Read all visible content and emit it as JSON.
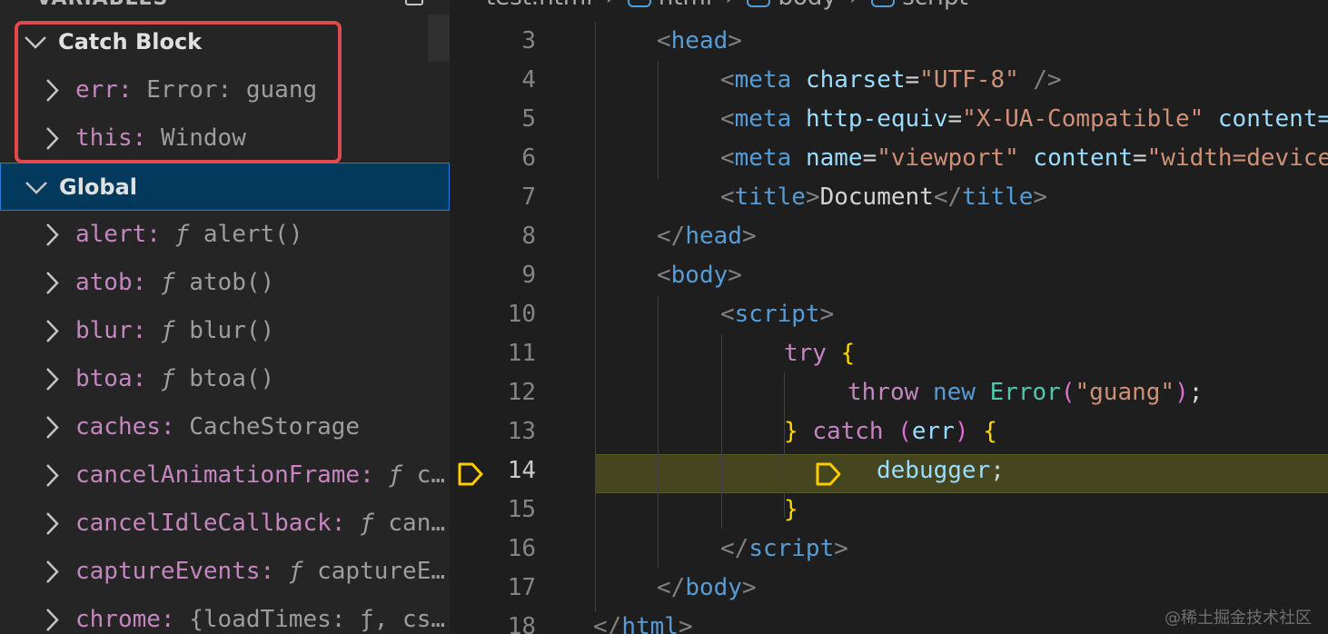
{
  "panel": {
    "title": "VARIABLES",
    "scopes": [
      {
        "label": "Catch Block",
        "expanded": true,
        "selected": false,
        "vars": [
          {
            "name": "err",
            "value": "Error: guang",
            "fn": false
          },
          {
            "name": "this",
            "value": "Window",
            "fn": false
          }
        ]
      },
      {
        "label": "Global",
        "expanded": true,
        "selected": true,
        "vars": [
          {
            "name": "alert",
            "value": "alert()",
            "fn": true
          },
          {
            "name": "atob",
            "value": "atob()",
            "fn": true
          },
          {
            "name": "blur",
            "value": "blur()",
            "fn": true
          },
          {
            "name": "btoa",
            "value": "btoa()",
            "fn": true
          },
          {
            "name": "caches",
            "value": "CacheStorage",
            "fn": false
          },
          {
            "name": "cancelAnimationFrame",
            "value": "c…",
            "fn": true
          },
          {
            "name": "cancelIdleCallback",
            "value": "can…",
            "fn": true
          },
          {
            "name": "captureEvents",
            "value": "captureE…",
            "fn": true
          },
          {
            "name": "chrome",
            "value": "{loadTimes: ƒ, cs…",
            "fn": false
          }
        ]
      }
    ],
    "fn_glyph": "ƒ"
  },
  "editor": {
    "breadcrumb": [
      "test.html",
      "html",
      "body",
      "script"
    ],
    "current_line": 14,
    "lines": [
      {
        "n": "3",
        "indent": 2,
        "tokens": [
          [
            "br",
            "<"
          ],
          [
            "tag",
            "head"
          ],
          [
            "br",
            ">"
          ]
        ]
      },
      {
        "n": "4",
        "indent": 4,
        "tokens": [
          [
            "br",
            "<"
          ],
          [
            "tag",
            "meta"
          ],
          [
            "text",
            " "
          ],
          [
            "attr",
            "charset"
          ],
          [
            "text",
            "="
          ],
          [
            "str",
            "\"UTF-8\""
          ],
          [
            "text",
            " "
          ],
          [
            "br",
            "/>"
          ]
        ]
      },
      {
        "n": "5",
        "indent": 4,
        "tokens": [
          [
            "br",
            "<"
          ],
          [
            "tag",
            "meta"
          ],
          [
            "text",
            " "
          ],
          [
            "attr",
            "http-equiv"
          ],
          [
            "text",
            "="
          ],
          [
            "str",
            "\"X-UA-Compatible\""
          ],
          [
            "text",
            " "
          ],
          [
            "attr",
            "content=\"IE=edge\""
          ]
        ]
      },
      {
        "n": "6",
        "indent": 4,
        "tokens": [
          [
            "br",
            "<"
          ],
          [
            "tag",
            "meta"
          ],
          [
            "text",
            " "
          ],
          [
            "attr",
            "name"
          ],
          [
            "text",
            "="
          ],
          [
            "str",
            "\"viewport\""
          ],
          [
            "text",
            " "
          ],
          [
            "attr",
            "content"
          ],
          [
            "text",
            "="
          ],
          [
            "str",
            "\"width=device-width\""
          ]
        ]
      },
      {
        "n": "7",
        "indent": 4,
        "tokens": [
          [
            "br",
            "<"
          ],
          [
            "tag",
            "title"
          ],
          [
            "br",
            ">"
          ],
          [
            "text",
            "Document"
          ],
          [
            "br",
            "</"
          ],
          [
            "tag",
            "title"
          ],
          [
            "br",
            ">"
          ]
        ]
      },
      {
        "n": "8",
        "indent": 2,
        "tokens": [
          [
            "br",
            "</"
          ],
          [
            "tag",
            "head"
          ],
          [
            "br",
            ">"
          ]
        ]
      },
      {
        "n": "9",
        "indent": 2,
        "tokens": [
          [
            "br",
            "<"
          ],
          [
            "tag",
            "body"
          ],
          [
            "br",
            ">"
          ]
        ]
      },
      {
        "n": "10",
        "indent": 4,
        "tokens": [
          [
            "br",
            "<"
          ],
          [
            "tag",
            "script"
          ],
          [
            "br",
            ">"
          ]
        ]
      },
      {
        "n": "11",
        "indent": 6,
        "tokens": [
          [
            "kw",
            "try"
          ],
          [
            "text",
            " "
          ],
          [
            "brace",
            "{"
          ]
        ]
      },
      {
        "n": "12",
        "indent": 8,
        "tokens": [
          [
            "kw",
            "throw"
          ],
          [
            "text",
            " "
          ],
          [
            "kw2",
            "new"
          ],
          [
            "text",
            " "
          ],
          [
            "cls",
            "Error"
          ],
          [
            "paren",
            "("
          ],
          [
            "str",
            "\"guang\""
          ],
          [
            "paren",
            ")"
          ],
          [
            "text",
            ";"
          ]
        ]
      },
      {
        "n": "13",
        "indent": 6,
        "tokens": [
          [
            "brace",
            "}"
          ],
          [
            "text",
            " "
          ],
          [
            "kw",
            "catch"
          ],
          [
            "text",
            " "
          ],
          [
            "paren",
            "("
          ],
          [
            "var",
            "err"
          ],
          [
            "paren",
            ")"
          ],
          [
            "text",
            " "
          ],
          [
            "brace",
            "{"
          ]
        ]
      },
      {
        "n": "14",
        "indent": 8,
        "tokens": [
          [
            "var",
            "debugger"
          ],
          [
            "text",
            ";"
          ]
        ]
      },
      {
        "n": "15",
        "indent": 6,
        "tokens": [
          [
            "brace",
            "}"
          ]
        ]
      },
      {
        "n": "16",
        "indent": 4,
        "tokens": [
          [
            "br",
            "</"
          ],
          [
            "tag",
            "script"
          ],
          [
            "br",
            ">"
          ]
        ]
      },
      {
        "n": "17",
        "indent": 2,
        "tokens": [
          [
            "br",
            "</"
          ],
          [
            "tag",
            "body"
          ],
          [
            "br",
            ">"
          ]
        ]
      },
      {
        "n": "18",
        "indent": 0,
        "tokens": [
          [
            "br",
            "</"
          ],
          [
            "tag",
            "html"
          ],
          [
            "br",
            ">"
          ]
        ]
      }
    ]
  },
  "watermark": "@稀土掘金技术社区",
  "colors": {
    "highlight": "#e2494d",
    "selection": "#04395e",
    "current_line": "#45451f"
  }
}
